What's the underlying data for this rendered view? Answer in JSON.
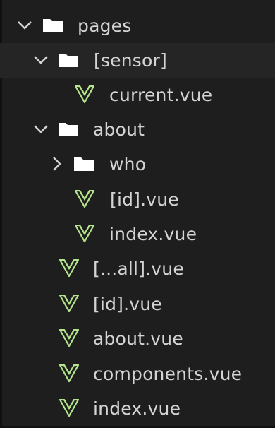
{
  "tree": {
    "items": [
      {
        "label": "pages",
        "type": "folder",
        "expanded": true
      },
      {
        "label": "[sensor]",
        "type": "folder",
        "expanded": true
      },
      {
        "label": "current.vue",
        "type": "vue"
      },
      {
        "label": "about",
        "type": "folder",
        "expanded": true
      },
      {
        "label": "who",
        "type": "folder",
        "expanded": false
      },
      {
        "label": "[id].vue",
        "type": "vue"
      },
      {
        "label": "index.vue",
        "type": "vue"
      },
      {
        "label": "[...all].vue",
        "type": "vue"
      },
      {
        "label": "[id].vue",
        "type": "vue"
      },
      {
        "label": "about.vue",
        "type": "vue"
      },
      {
        "label": "components.vue",
        "type": "vue"
      },
      {
        "label": "index.vue",
        "type": "vue"
      }
    ]
  },
  "colors": {
    "background": "#1e1e1e",
    "highlight": "#252526",
    "text": "#d4d4d4",
    "folder": "#ffffff",
    "vue_icon": "#b5e48c"
  }
}
